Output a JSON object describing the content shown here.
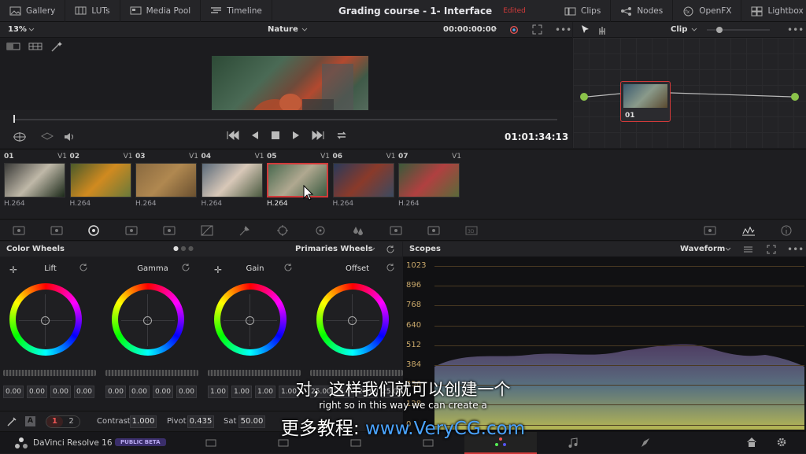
{
  "topbar": {
    "left": [
      {
        "icon": "gallery-icon",
        "label": "Gallery"
      },
      {
        "icon": "luts-icon",
        "label": "LUTs"
      },
      {
        "icon": "media-pool-icon",
        "label": "Media Pool"
      },
      {
        "icon": "timeline-icon",
        "label": "Timeline"
      }
    ],
    "project_title": "Grading course - 1- Interface",
    "edited": "Edited",
    "right": [
      {
        "icon": "clips-icon",
        "label": "Clips"
      },
      {
        "icon": "nodes-icon",
        "label": "Nodes"
      },
      {
        "icon": "openfx-icon",
        "label": "OpenFX"
      },
      {
        "icon": "lightbox-icon",
        "label": "Lightbox"
      }
    ]
  },
  "viewer": {
    "zoom": "13%",
    "clip_name": "Nature",
    "timecode_top": "00:00:00:00",
    "timecode": "01:01:34:13"
  },
  "nodes": {
    "mode": "Clip",
    "node_label": "01"
  },
  "clips": [
    {
      "num": "01",
      "track": "V1",
      "codec": "H.264",
      "thumb": "#3a3a38,#bfb8a8,#1c2a1a"
    },
    {
      "num": "02",
      "track": "V1",
      "codec": "H.264",
      "thumb": "#4a5a2a,#d08a20,#6a7a3a"
    },
    {
      "num": "03",
      "track": "V1",
      "codec": "H.264",
      "thumb": "#8a6a40,#b08850,#6a5030"
    },
    {
      "num": "04",
      "track": "V1",
      "codec": "H.264",
      "thumb": "#5a6a7a,#d8c8b8,#4a5a40"
    },
    {
      "num": "05",
      "track": "V1",
      "codec": "H.264",
      "thumb": "#4a6a50,#b0a890,#3a5a40",
      "selected": true
    },
    {
      "num": "06",
      "track": "V1",
      "codec": "H.264",
      "thumb": "#2a3a5a,#8a3a2a,#3a4a60"
    },
    {
      "num": "07",
      "track": "V1",
      "codec": "H.264",
      "thumb": "#3a5a3a,#b04040,#5a6a3a"
    }
  ],
  "color_wheels": {
    "title": "Color Wheels",
    "mode": "Primaries Wheels",
    "wheels": [
      {
        "label": "Lift",
        "values": [
          "0.00",
          "0.00",
          "0.00",
          "0.00"
        ]
      },
      {
        "label": "Gamma",
        "values": [
          "0.00",
          "0.00",
          "0.00",
          "0.00"
        ]
      },
      {
        "label": "Gain",
        "values": [
          "1.00",
          "1.00",
          "1.00",
          "1.00"
        ]
      },
      {
        "label": "Offset",
        "values": [
          "25.00",
          "25.00",
          "25.00",
          "25.00"
        ]
      }
    ]
  },
  "adjust": {
    "auto": "A",
    "page1": "1",
    "page2": "2",
    "contrast_label": "Contrast",
    "contrast_value": "1.000",
    "pivot_label": "Pivot",
    "pivot_value": "0.435",
    "sat_label": "Sat",
    "sat_value": "50.00"
  },
  "scopes": {
    "title": "Scopes",
    "mode": "Waveform",
    "ticks": [
      "1023",
      "896",
      "768",
      "640",
      "512",
      "384",
      "256",
      "128",
      "0"
    ]
  },
  "status": {
    "app": "DaVinci Resolve 16",
    "badge": "PUBLIC BETA"
  },
  "subtitles": {
    "line_cn": "对，这样我们就可以创建一个",
    "line_en": "right so in this way we can create a",
    "line_cn2": "更多教程:",
    "watermark": "www.VeryCG.com"
  },
  "colors": {
    "accent_red": "#d23a3a",
    "node_green": "#8bc34a",
    "badge": "#6a4fb0",
    "watermark": "#4aa3ff"
  }
}
